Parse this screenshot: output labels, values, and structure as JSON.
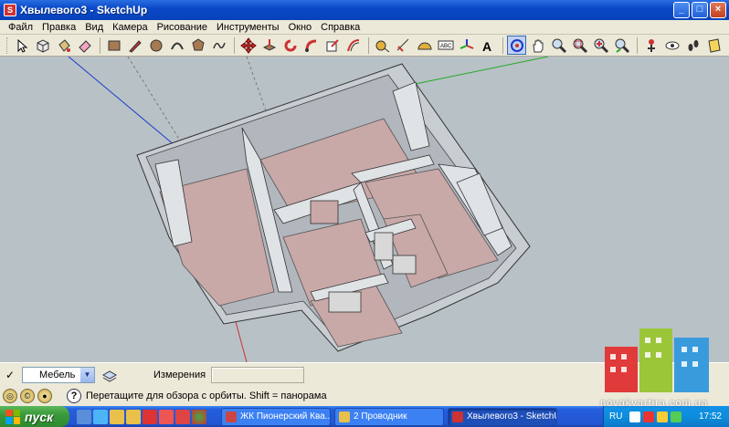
{
  "window": {
    "title": "Хвылевого3 - SketchUp"
  },
  "menu": [
    "Файл",
    "Правка",
    "Вид",
    "Камера",
    "Рисование",
    "Инструменты",
    "Окно",
    "Справка"
  ],
  "statusbar": {
    "layer_value": "Мебель",
    "measurements_label": "Измерения",
    "measurements_value": "",
    "hint": "Перетащите для обзора с орбиты.  Shift = панорама"
  },
  "taskbar": {
    "start_label": "пуск",
    "tasks": [
      {
        "label": "ЖК Пионерский Ква..."
      },
      {
        "label": "2 Проводник"
      },
      {
        "label": "Хвылевого3 - SketchUp"
      }
    ],
    "lang": "RU",
    "clock": "17:52"
  },
  "watermark": {
    "text": "novakvartira.com.ua"
  },
  "colors": {
    "title_blue": "#0a49c9",
    "viewport_bg": "#b8c1c6",
    "floor": "#c9a8a8",
    "taskbar": "#245edb",
    "start_green": "#3a9a3a"
  }
}
